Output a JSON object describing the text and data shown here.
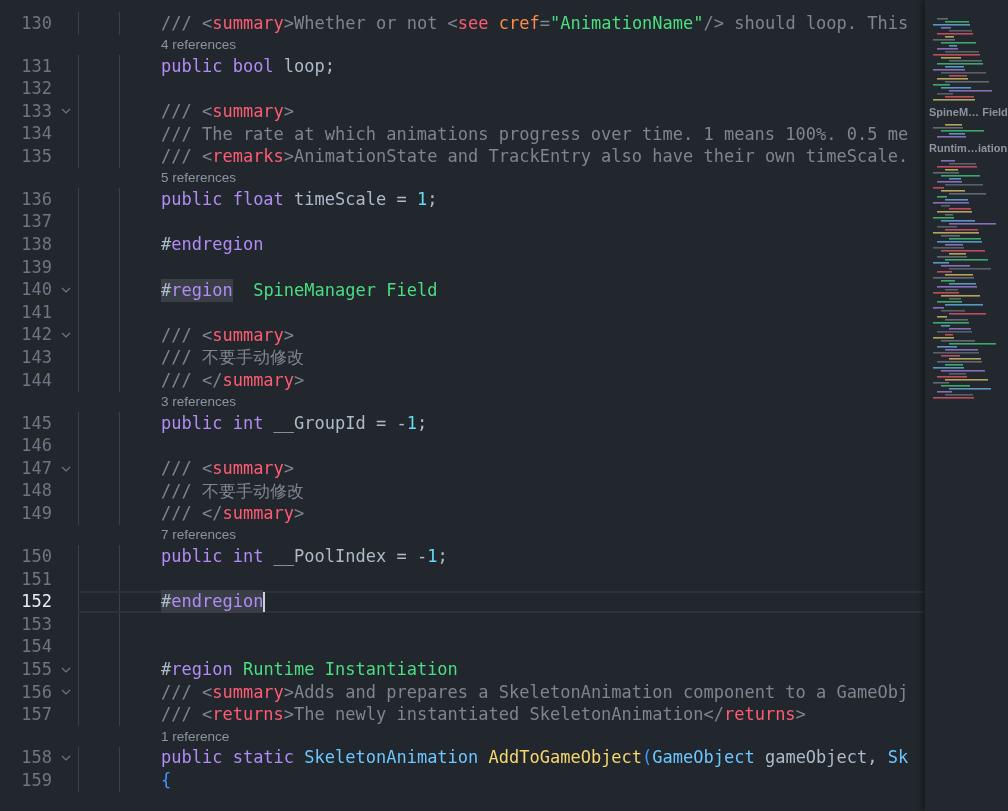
{
  "editor": {
    "lines": [
      {
        "kind": "code",
        "number": "130",
        "fold": false,
        "current": false,
        "tokens": [
          {
            "kind": "comment",
            "text": "/// <"
          },
          {
            "kind": "tag",
            "text": "summary"
          },
          {
            "kind": "comment",
            "text": ">Whether or not <"
          },
          {
            "kind": "tag",
            "text": "see"
          },
          {
            "kind": "attr",
            "text": " cref"
          },
          {
            "kind": "comment",
            "text": "="
          },
          {
            "kind": "string",
            "text": "\"AnimationName\""
          },
          {
            "kind": "comment",
            "text": "/> should loop. This"
          }
        ]
      },
      {
        "kind": "lens",
        "text": "4 references"
      },
      {
        "kind": "code",
        "number": "131",
        "fold": false,
        "current": false,
        "tokens": [
          {
            "kind": "keyword",
            "text": "public "
          },
          {
            "kind": "keyword",
            "text": "bool"
          },
          {
            "kind": "plain",
            "text": " loop;"
          }
        ]
      },
      {
        "kind": "code",
        "number": "132",
        "fold": false,
        "current": false
      },
      {
        "kind": "code",
        "number": "133",
        "fold": true,
        "current": false,
        "tokens": [
          {
            "kind": "comment",
            "text": "/// <"
          },
          {
            "kind": "tag",
            "text": "summary"
          },
          {
            "kind": "comment",
            "text": ">"
          }
        ]
      },
      {
        "kind": "code",
        "number": "134",
        "fold": false,
        "current": false,
        "tokens": [
          {
            "kind": "comment",
            "text": "/// The rate at which animations progress over time. 1 means 100%. 0.5 me"
          }
        ]
      },
      {
        "kind": "code",
        "number": "135",
        "fold": false,
        "current": false,
        "tokens": [
          {
            "kind": "comment",
            "text": "/// <"
          },
          {
            "kind": "tag",
            "text": "remarks"
          },
          {
            "kind": "comment",
            "text": ">AnimationState and TrackEntry also have their own timeScale."
          }
        ]
      },
      {
        "kind": "lens",
        "text": "5 references"
      },
      {
        "kind": "code",
        "number": "136",
        "fold": false,
        "current": false,
        "tokens": [
          {
            "kind": "keyword",
            "text": "public "
          },
          {
            "kind": "keyword",
            "text": "float"
          },
          {
            "kind": "plain",
            "text": " timeScale = "
          },
          {
            "kind": "number",
            "text": "1"
          },
          {
            "kind": "plain",
            "text": ";"
          }
        ]
      },
      {
        "kind": "code",
        "number": "137",
        "fold": false,
        "current": false
      },
      {
        "kind": "code",
        "number": "138",
        "fold": false,
        "current": false,
        "tokens": [
          {
            "kind": "directive",
            "text": "#endregion"
          }
        ]
      },
      {
        "kind": "code",
        "number": "139",
        "fold": false,
        "current": false
      },
      {
        "kind": "code",
        "number": "140",
        "fold": true,
        "current": false,
        "tokens": [
          {
            "kind": "directive_selected",
            "text": "#region"
          },
          {
            "kind": "region",
            "text": "  SpineManager Field"
          }
        ]
      },
      {
        "kind": "code",
        "number": "141",
        "fold": false,
        "current": false
      },
      {
        "kind": "code",
        "number": "142",
        "fold": true,
        "current": false,
        "tokens": [
          {
            "kind": "comment",
            "text": "/// <"
          },
          {
            "kind": "tag",
            "text": "summary"
          },
          {
            "kind": "comment",
            "text": ">"
          }
        ]
      },
      {
        "kind": "code",
        "number": "143",
        "fold": false,
        "current": false,
        "tokens": [
          {
            "kind": "comment",
            "text": "/// 不要手动修改"
          }
        ]
      },
      {
        "kind": "code",
        "number": "144",
        "fold": false,
        "current": false,
        "tokens": [
          {
            "kind": "comment",
            "text": "/// </"
          },
          {
            "kind": "tag",
            "text": "summary"
          },
          {
            "kind": "comment",
            "text": ">"
          }
        ]
      },
      {
        "kind": "lens",
        "text": "3 references"
      },
      {
        "kind": "code",
        "number": "145",
        "fold": false,
        "current": false,
        "tokens": [
          {
            "kind": "keyword",
            "text": "public "
          },
          {
            "kind": "keyword",
            "text": "int"
          },
          {
            "kind": "plain",
            "text": " __GroupId = -"
          },
          {
            "kind": "number",
            "text": "1"
          },
          {
            "kind": "plain",
            "text": ";"
          }
        ]
      },
      {
        "kind": "code",
        "number": "146",
        "fold": false,
        "current": false
      },
      {
        "kind": "code",
        "number": "147",
        "fold": true,
        "current": false,
        "tokens": [
          {
            "kind": "comment",
            "text": "/// <"
          },
          {
            "kind": "tag",
            "text": "summary"
          },
          {
            "kind": "comment",
            "text": ">"
          }
        ]
      },
      {
        "kind": "code",
        "number": "148",
        "fold": false,
        "current": false,
        "tokens": [
          {
            "kind": "comment",
            "text": "/// 不要手动修改"
          }
        ]
      },
      {
        "kind": "code",
        "number": "149",
        "fold": false,
        "current": false,
        "tokens": [
          {
            "kind": "comment",
            "text": "/// </"
          },
          {
            "kind": "tag",
            "text": "summary"
          },
          {
            "kind": "comment",
            "text": ">"
          }
        ]
      },
      {
        "kind": "lens",
        "text": "7 references"
      },
      {
        "kind": "code",
        "number": "150",
        "fold": false,
        "current": false,
        "tokens": [
          {
            "kind": "keyword",
            "text": "public "
          },
          {
            "kind": "keyword",
            "text": "int"
          },
          {
            "kind": "plain",
            "text": " __PoolIndex = -"
          },
          {
            "kind": "number",
            "text": "1"
          },
          {
            "kind": "plain",
            "text": ";"
          }
        ]
      },
      {
        "kind": "code",
        "number": "151",
        "fold": false,
        "current": false
      },
      {
        "kind": "code",
        "number": "152",
        "fold": false,
        "current": true,
        "tokens": [
          {
            "kind": "directive_selected",
            "text": "#endregion"
          }
        ]
      },
      {
        "kind": "code",
        "number": "153",
        "fold": false,
        "current": false
      },
      {
        "kind": "code",
        "number": "154",
        "fold": false,
        "current": false
      },
      {
        "kind": "code",
        "number": "155",
        "fold": true,
        "current": false,
        "tokens": [
          {
            "kind": "directive",
            "text": "#region"
          },
          {
            "kind": "region",
            "text": " Runtime Instantiation"
          }
        ]
      },
      {
        "kind": "code",
        "number": "156",
        "fold": true,
        "current": false,
        "tokens": [
          {
            "kind": "comment",
            "text": "/// <"
          },
          {
            "kind": "tag",
            "text": "summary"
          },
          {
            "kind": "comment",
            "text": ">Adds and prepares a SkeletonAnimation component to a GameObj"
          }
        ]
      },
      {
        "kind": "code",
        "number": "157",
        "fold": false,
        "current": false,
        "tokens": [
          {
            "kind": "comment",
            "text": "/// <"
          },
          {
            "kind": "tag",
            "text": "returns"
          },
          {
            "kind": "comment",
            "text": ">The newly instantiated SkeletonAnimation</"
          },
          {
            "kind": "tag",
            "text": "returns"
          },
          {
            "kind": "comment",
            "text": ">"
          }
        ]
      },
      {
        "kind": "lens",
        "text": "1 reference"
      },
      {
        "kind": "code",
        "number": "158",
        "fold": true,
        "current": false,
        "tokens": [
          {
            "kind": "keyword",
            "text": "public "
          },
          {
            "kind": "keyword",
            "text": "static"
          },
          {
            "kind": "type",
            "text": " SkeletonAnimation"
          },
          {
            "kind": "method",
            "text": " AddToGameObject"
          },
          {
            "kind": "bracket",
            "text": "("
          },
          {
            "kind": "type",
            "text": "GameObject"
          },
          {
            "kind": "plain",
            "text": " gameObject, "
          },
          {
            "kind": "type",
            "text": "Sk"
          }
        ]
      },
      {
        "kind": "code",
        "number": "159",
        "fold": false,
        "current": false,
        "tokens": [
          {
            "kind": "bracket",
            "text": "{"
          }
        ]
      }
    ]
  },
  "minimap": {
    "headings": [
      "SpineM… Field",
      "Runtim…iation"
    ]
  }
}
